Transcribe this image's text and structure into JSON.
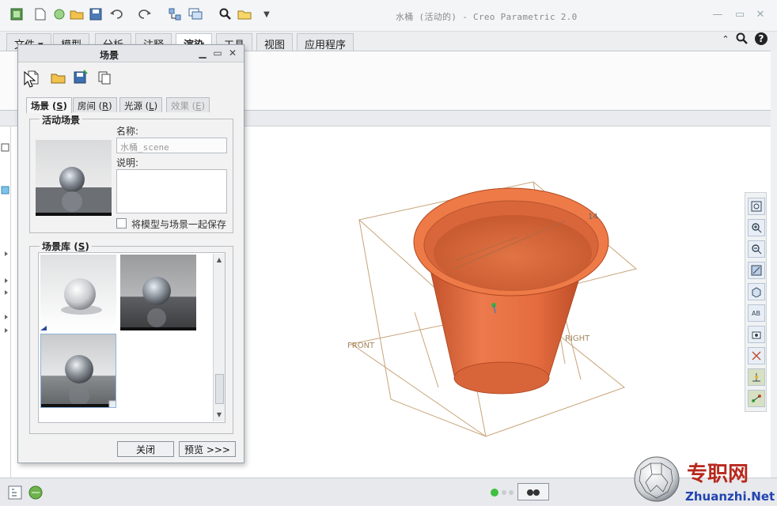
{
  "window": {
    "title": "水桶 (活动的) - Creo Parametric 2.0"
  },
  "quick_access": [
    {
      "icon": "new-file-icon"
    },
    {
      "icon": "open-icon"
    },
    {
      "icon": "save-icon"
    },
    {
      "icon": "undo-icon"
    },
    {
      "icon": "redo-icon"
    },
    {
      "icon": "regenerate-icon"
    },
    {
      "icon": "windows-icon"
    },
    {
      "icon": "search-icon"
    },
    {
      "icon": "close-window-icon"
    }
  ],
  "ribbon_tabs": [
    {
      "label": "文件",
      "suffix": "▾"
    },
    {
      "label": "模型"
    },
    {
      "label": "分析"
    },
    {
      "label": "注释"
    },
    {
      "label": "渲染",
      "active": true
    },
    {
      "label": "工具"
    },
    {
      "label": "视图"
    },
    {
      "label": "应用程序"
    }
  ],
  "dialog": {
    "title": "场景",
    "tabs": [
      {
        "label": "场景",
        "key": "S",
        "active": true
      },
      {
        "label": "房间",
        "key": "R"
      },
      {
        "label": "光源",
        "key": "L"
      },
      {
        "label": "效果",
        "key": "E",
        "disabled": true
      }
    ],
    "active_scene": {
      "group_label": "活动场景",
      "name_label": "名称:",
      "name_value": "水桶_scene",
      "description_label": "说明:",
      "save_with_model_label": "将模型与场景一起保存"
    },
    "library": {
      "group_label": "场景库",
      "key": "S",
      "thumbnails": [
        {
          "name": "white-sphere-scene"
        },
        {
          "name": "dark-room-sphere-scene"
        },
        {
          "name": "reflective-floor-sphere-scene"
        }
      ]
    },
    "buttons": {
      "close": "关闭",
      "preview": "预览 >>>"
    }
  },
  "graphics": {
    "datum_labels": {
      "front": "FRONT",
      "right": "RIGHT",
      "dim": "14"
    },
    "model_color": "#e06a3f"
  },
  "watermark": {
    "brand_cn": "专职网",
    "brand_url": "Zhuanzhi.Net"
  },
  "colors": {
    "accent": "#c8a47a",
    "model": "#e06a3f"
  }
}
